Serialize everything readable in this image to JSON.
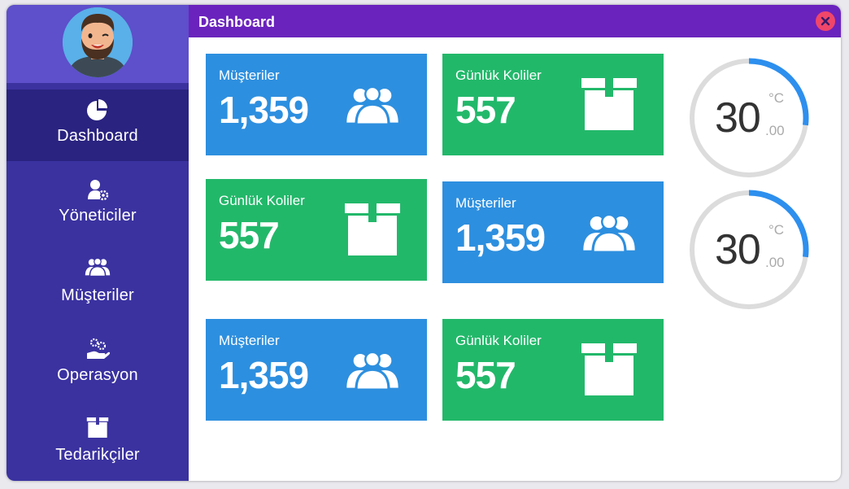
{
  "window": {
    "title": "Dashboard"
  },
  "sidebar": {
    "items": [
      {
        "label": "Dashboard",
        "icon": "pie-chart-icon",
        "active": true
      },
      {
        "label": "Yöneticiler",
        "icon": "user-gear-icon",
        "active": false
      },
      {
        "label": "Müşteriler",
        "icon": "users-icon",
        "active": false
      },
      {
        "label": "Operasyon",
        "icon": "hand-gears-icon",
        "active": false
      },
      {
        "label": "Tedarikçiler",
        "icon": "box-icon",
        "active": false
      }
    ]
  },
  "cards": [
    {
      "label": "Müşteriler",
      "value": "1,359",
      "color": "#2d8fdf",
      "icon": "users-icon"
    },
    {
      "label": "Günlük Koliler",
      "value": "557",
      "color": "#22b86a",
      "icon": "box-icon"
    },
    {
      "label": "Günlük Koliler",
      "value": "557",
      "color": "#22b86a",
      "icon": "box-icon"
    },
    {
      "label": "Müşteriler",
      "value": "1,359",
      "color": "#2d8fdf",
      "icon": "users-icon"
    },
    {
      "label": "Müşteriler",
      "value": "1,359",
      "color": "#2d8fdf",
      "icon": "users-icon"
    },
    {
      "label": "Günlük Koliler",
      "value": "557",
      "color": "#22b86a",
      "icon": "box-icon"
    }
  ],
  "gauges": [
    {
      "value": "30",
      "unit": "°C",
      "decimal": ".00",
      "progress": 0.27
    },
    {
      "value": "30",
      "unit": "°C",
      "decimal": ".00",
      "progress": 0.27
    }
  ],
  "colors": {
    "sidebar": "#3b32a0",
    "sidebar_active": "#2a2380",
    "titlebar": "#6a23bd",
    "blue": "#2d8fdf",
    "green": "#22b86a",
    "gauge_arc": "#2d8fee",
    "gauge_track": "#dcdcdc"
  }
}
